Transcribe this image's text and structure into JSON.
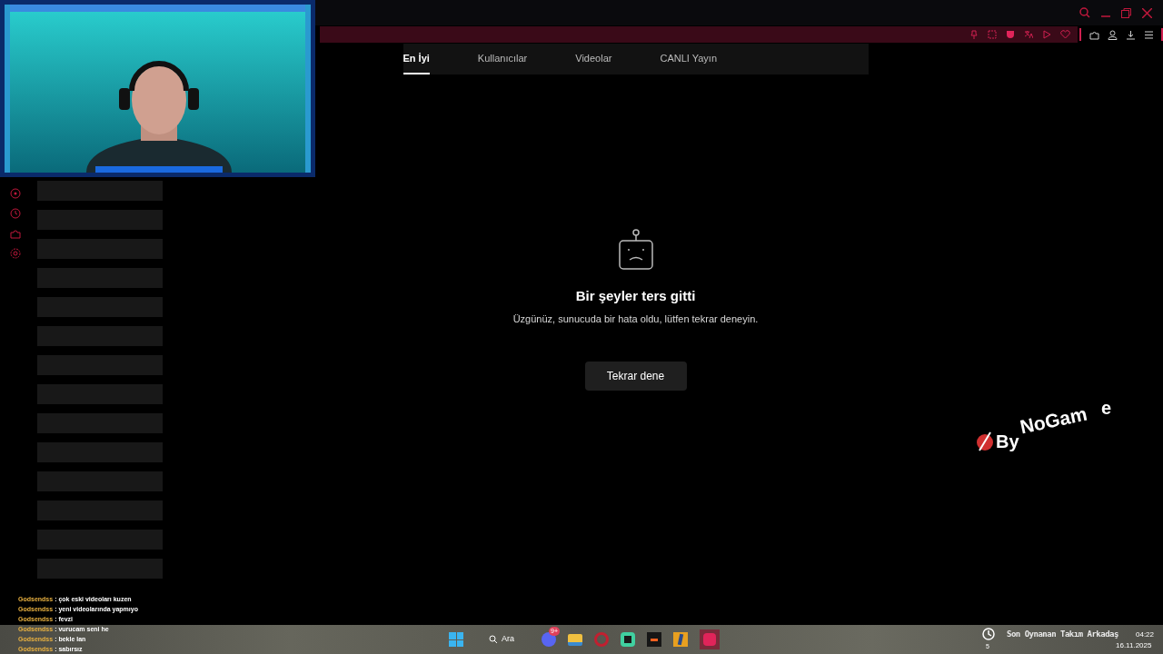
{
  "tabs": [
    {
      "label": "En İyi",
      "selected": true
    },
    {
      "label": "Kullanıcılar",
      "selected": false
    },
    {
      "label": "Videolar",
      "selected": false
    },
    {
      "label": "CANLI Yayın",
      "selected": false
    }
  ],
  "error": {
    "title": "Bir şeyler ters gitti",
    "message": "Üzgünüz, sunucuda bir hata oldu, lütfen tekrar deneyin.",
    "button": "Tekrar dene"
  },
  "chat": [
    {
      "user": "Godsendss",
      "message": ": çok eski videoları kuzen"
    },
    {
      "user": "Godsendss",
      "message": ": yeni videolarında yapmıyo"
    },
    {
      "user": "Godsendss",
      "message": ": fevzi"
    },
    {
      "user": "Godsendss",
      "message": ": vurucam seni he"
    },
    {
      "user": "Godsendss",
      "message": ": bekle lan"
    },
    {
      "user": "Godsendss",
      "message": ": sabırsız"
    }
  ],
  "logo_parts": [
    "By",
    "NoGam",
    "e"
  ],
  "recent_teammates": "Son Oynanan Takım Arkadaş",
  "taskbar": {
    "search": "Ara",
    "discord_badge": "9+",
    "history_count": "5",
    "time": "04:22",
    "date": "16.11.2025"
  }
}
